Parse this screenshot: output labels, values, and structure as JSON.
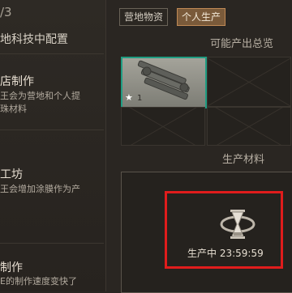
{
  "left": {
    "level": "/3",
    "section_title": "地科技中配置",
    "items": [
      {
        "title": "店制作",
        "desc": "王会为营地和个人提\n珠材料"
      },
      {
        "title": "工坊",
        "desc": "王会增加涂膜作为产"
      },
      {
        "title": "制作",
        "desc": "E的制作速度变快了"
      }
    ]
  },
  "tabs": [
    {
      "label": "营地物资",
      "active": false
    },
    {
      "label": "个人生产",
      "active": true
    }
  ],
  "output_title": "可能产出总览",
  "slot_item": {
    "star": "★",
    "qty": "1",
    "icon": "metal-rods-icon"
  },
  "materials_title": "生产材料",
  "production": {
    "status": "生产中 23:59:59",
    "icon": "hourglass-icon"
  },
  "colors": {
    "accent": "#e01c1c",
    "active_tab": "#7a5a3a",
    "rarity": "#1f9d82"
  }
}
